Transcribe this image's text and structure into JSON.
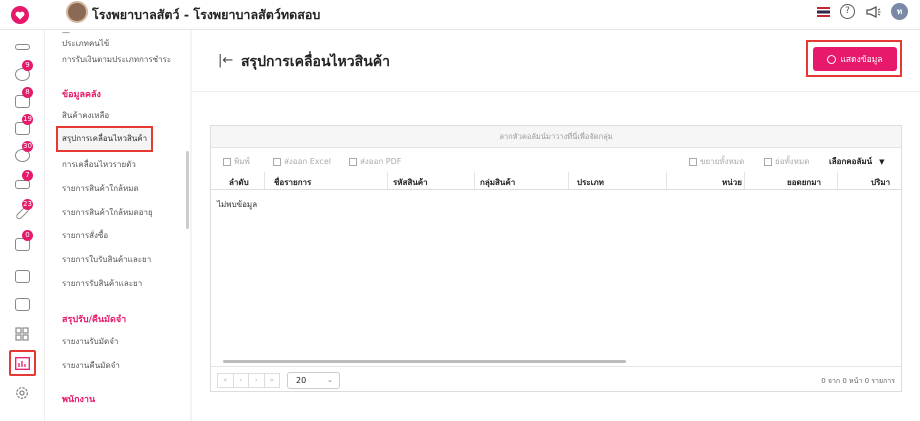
{
  "header": {
    "title": "โรงพยาบาลสัตว์ - โรงพยาบาลสัตว์ทดสอบ",
    "user_initial": "ท",
    "help_icon": "help-circle-icon",
    "announce_icon": "megaphone-icon"
  },
  "rail": {
    "items": [
      {
        "icon": "stethoscope-icon",
        "badge": ""
      },
      {
        "icon": "vet-visit-icon",
        "badge": "9"
      },
      {
        "icon": "bed-icon",
        "badge": "8"
      },
      {
        "icon": "box-icon",
        "badge": "19"
      },
      {
        "icon": "moon-icon",
        "badge": "30"
      },
      {
        "icon": "hand-icon",
        "badge": "7"
      },
      {
        "icon": "syringe-icon",
        "badge": "23"
      },
      {
        "icon": "lab-icon",
        "badge": "0"
      },
      {
        "icon": "cash-register-icon",
        "badge": ""
      },
      {
        "icon": "package-icon",
        "badge": ""
      },
      {
        "icon": "apps-grid-icon",
        "badge": ""
      },
      {
        "icon": "report-chart-icon",
        "badge": ""
      },
      {
        "icon": "settings-icon",
        "badge": ""
      }
    ]
  },
  "submenu": {
    "links_top": [
      "ประเภทคนไข้",
      "การรับเงินตามประเภทการชำระ"
    ],
    "section_inventory": "ข้อมูลคลัง",
    "inventory_links": [
      "สินค้าคงเหลือ",
      "สรุปการเคลื่อนไหวสินค้า",
      "การเคลื่อนไหวรายตัว",
      "รายการสินค้าใกล้หมด",
      "รายการสินค้าใกล้หมดอายุ",
      "รายการสั่งซื้อ",
      "รายการใบรับสินค้าและยา",
      "รายการรับสินค้าและยา"
    ],
    "section_appointments": "สรุปรับ/คืนมัดจำ",
    "appointment_links": [
      "รายงานรับมัดจำ",
      "รายงานคืนมัดจำ"
    ],
    "section_staff": "พนักงาน"
  },
  "main": {
    "page_title": "สรุปการเคลื่อนไหวสินค้า",
    "show_data_button": "แสดงข้อมูล",
    "grid": {
      "group_hint": "ลากหัวคอลัมน์มาวางที่นี่เพื่อจัดกลุ่ม",
      "toolbar": {
        "print": "พิมพ์",
        "export_excel": "ส่งออก Excel",
        "export_pdf": "ส่งออก PDF",
        "expand_all": "ขยายทั้งหมด",
        "collapse_all": "ย่อทั้งหมด",
        "choose_columns": "เลือกคอลัมน์"
      },
      "columns": [
        "ลำดับ",
        "ชื่อรายการ",
        "รหัสสินค้า",
        "กลุ่มสินค้า",
        "ประเภท",
        "หน่วย",
        "ยอดยกมา",
        "ปริมา"
      ],
      "empty_message": "ไม่พบข้อมูล",
      "page_size": "20",
      "page_info": "0 จาก 0 หน้า 0 รายการ"
    }
  }
}
